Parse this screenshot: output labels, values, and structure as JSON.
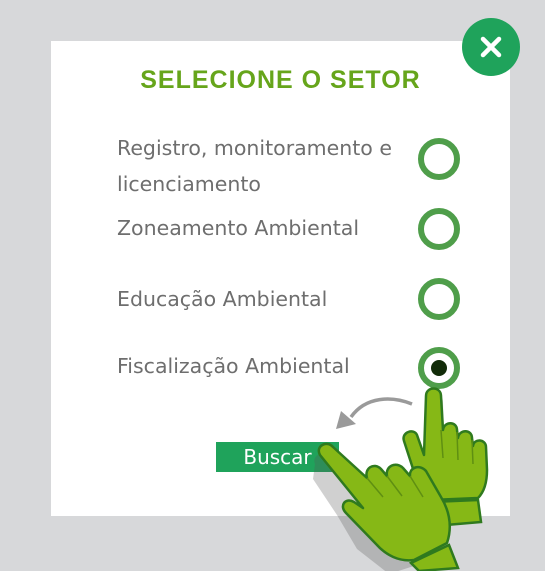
{
  "dialog": {
    "title": "SELECIONE O SETOR",
    "options": [
      {
        "label": "Registro, monitoramento e licenciamento",
        "selected": false
      },
      {
        "label": "Zoneamento Ambiental",
        "selected": false
      },
      {
        "label": "Educação Ambiental",
        "selected": false
      },
      {
        "label": "Fiscalização Ambiental",
        "selected": true
      }
    ],
    "search_label": "Buscar"
  },
  "icons": {
    "close": "close-icon",
    "hand_pointer": "hand-pointer-icon",
    "arrow": "curved-arrow-icon"
  },
  "colors": {
    "accent_green": "#1fa35b",
    "title_green": "#66a51b",
    "radio_green": "#4f9e4a",
    "radio_dot": "#122c09",
    "hand_green": "#86b816",
    "text_gray": "#6e6e6e",
    "backdrop": "#d7d8da"
  }
}
